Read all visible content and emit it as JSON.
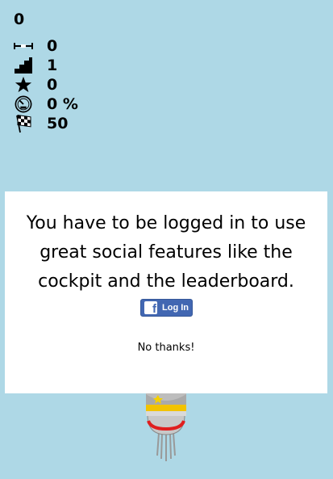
{
  "hud": {
    "score": "0",
    "stats": [
      {
        "icon": "distance-icon",
        "value": "0"
      },
      {
        "icon": "stairs-icon",
        "value": "1"
      },
      {
        "icon": "star-icon",
        "value": "0"
      },
      {
        "icon": "speedometer-icon",
        "value": "0 %"
      },
      {
        "icon": "checkered-flag-icon",
        "value": "50"
      }
    ]
  },
  "dialog": {
    "message": "You have to be logged in to use great social features like the cockpit and the leaderboard.",
    "login_label": "Log In",
    "dismiss_label": "No thanks!"
  },
  "colors": {
    "background": "#aed8e6",
    "facebook": "#4267b2"
  }
}
